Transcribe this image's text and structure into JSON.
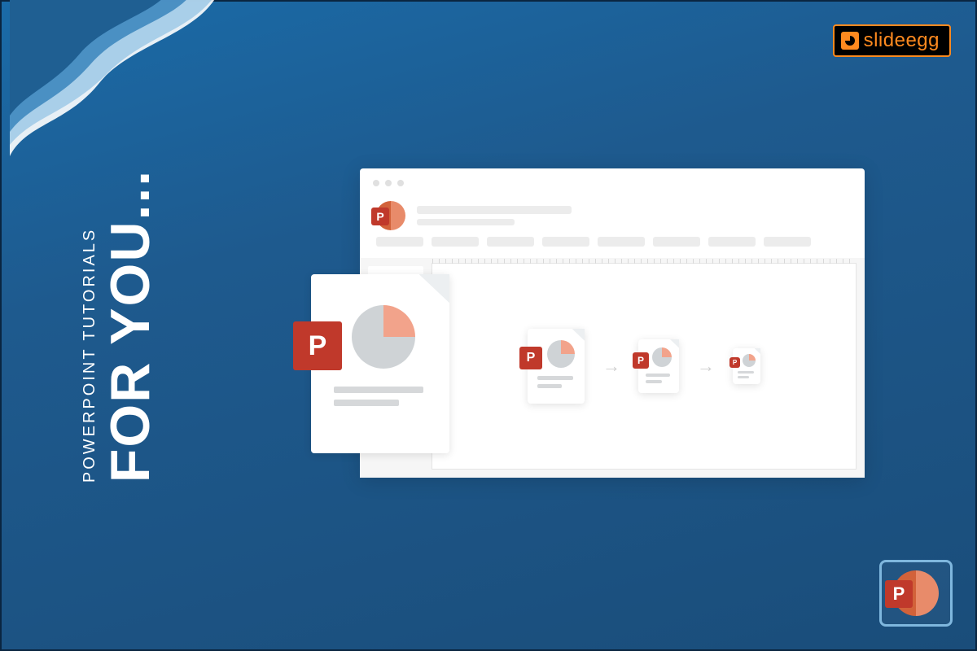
{
  "banner": {
    "subtitle": "POWERPOINT TUTORIALS",
    "title": "FOR YOU..."
  },
  "logo": {
    "text": "slideegg"
  },
  "icons": {
    "p_letter": "P"
  },
  "colors": {
    "accent_orange": "#ff8a1f",
    "ppt_red": "#c0392b",
    "bg_blue": "#1a5a8e"
  }
}
